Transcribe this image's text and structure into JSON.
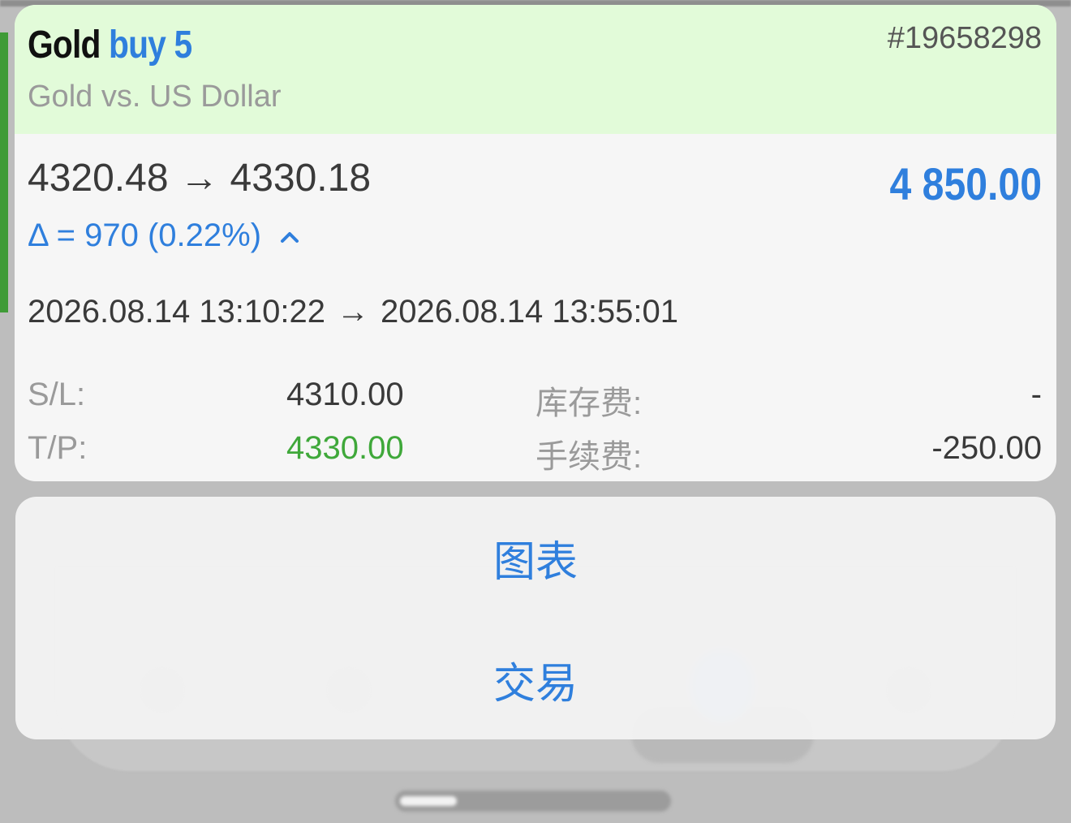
{
  "position": {
    "symbol": "Gold",
    "side_volume": "buy 5",
    "description": "Gold vs. US Dollar",
    "ticket": "#19658298",
    "open_price": "4320.48",
    "close_price": "4330.18",
    "arrow": "→",
    "profit": "4 850.00",
    "delta": "Δ = 970 (0.22%)",
    "open_time": "2026.08.14 13:10:22",
    "close_time": "2026.08.14 13:55:01",
    "sl_label": "S/L:",
    "sl_value": "4310.00",
    "tp_label": "T/P:",
    "tp_value": "4330.00",
    "swap_label": "库存费:",
    "swap_value": "-",
    "commission_label": "手续费:",
    "commission_value": "-250.00"
  },
  "actions": {
    "chart": "图表",
    "trade": "交易"
  },
  "colors": {
    "accent_blue": "#2f7fdd",
    "profit_green": "#3fa83a",
    "header_green": "#e2fbd9"
  }
}
